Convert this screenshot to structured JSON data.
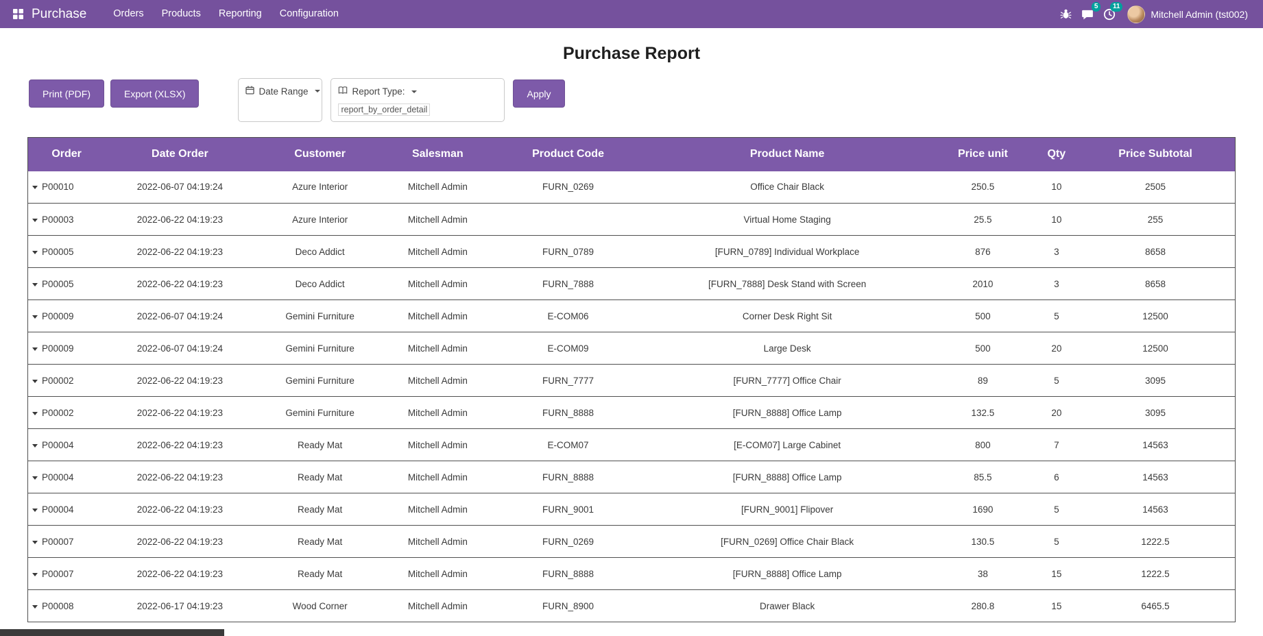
{
  "navbar": {
    "brand": "Purchase",
    "menu_items": [
      "Orders",
      "Products",
      "Reporting",
      "Configuration"
    ],
    "messages_badge": "5",
    "activities_badge": "11",
    "user": "Mitchell Admin (tst002)"
  },
  "page": {
    "title": "Purchase Report",
    "print_button": "Print (PDF)",
    "export_button": "Export (XLSX)",
    "date_range_label": "Date Range",
    "report_type_label": "Report Type:",
    "report_type_value": "report_by_order_detail",
    "apply_button": "Apply"
  },
  "table": {
    "columns": [
      "Order",
      "Date Order",
      "Customer",
      "Salesman",
      "Product Code",
      "Product Name",
      "Price unit",
      "Qty",
      "Price Subtotal"
    ],
    "rows": [
      {
        "order": "P00010",
        "date": "2022-06-07 04:19:24",
        "customer": "Azure Interior",
        "salesman": "Mitchell Admin",
        "code": "FURN_0269",
        "name": "Office Chair Black",
        "price": "250.5",
        "qty": "10",
        "subtotal": "2505"
      },
      {
        "order": "P00003",
        "date": "2022-06-22 04:19:23",
        "customer": "Azure Interior",
        "salesman": "Mitchell Admin",
        "code": "",
        "name": "Virtual Home Staging",
        "price": "25.5",
        "qty": "10",
        "subtotal": "255"
      },
      {
        "order": "P00005",
        "date": "2022-06-22 04:19:23",
        "customer": "Deco Addict",
        "salesman": "Mitchell Admin",
        "code": "FURN_0789",
        "name": "[FURN_0789] Individual Workplace",
        "price": "876",
        "qty": "3",
        "subtotal": "8658"
      },
      {
        "order": "P00005",
        "date": "2022-06-22 04:19:23",
        "customer": "Deco Addict",
        "salesman": "Mitchell Admin",
        "code": "FURN_7888",
        "name": "[FURN_7888] Desk Stand with Screen",
        "price": "2010",
        "qty": "3",
        "subtotal": "8658"
      },
      {
        "order": "P00009",
        "date": "2022-06-07 04:19:24",
        "customer": "Gemini Furniture",
        "salesman": "Mitchell Admin",
        "code": "E-COM06",
        "name": "Corner Desk Right Sit",
        "price": "500",
        "qty": "5",
        "subtotal": "12500"
      },
      {
        "order": "P00009",
        "date": "2022-06-07 04:19:24",
        "customer": "Gemini Furniture",
        "salesman": "Mitchell Admin",
        "code": "E-COM09",
        "name": "Large Desk",
        "price": "500",
        "qty": "20",
        "subtotal": "12500"
      },
      {
        "order": "P00002",
        "date": "2022-06-22 04:19:23",
        "customer": "Gemini Furniture",
        "salesman": "Mitchell Admin",
        "code": "FURN_7777",
        "name": "[FURN_7777] Office Chair",
        "price": "89",
        "qty": "5",
        "subtotal": "3095"
      },
      {
        "order": "P00002",
        "date": "2022-06-22 04:19:23",
        "customer": "Gemini Furniture",
        "salesman": "Mitchell Admin",
        "code": "FURN_8888",
        "name": "[FURN_8888] Office Lamp",
        "price": "132.5",
        "qty": "20",
        "subtotal": "3095"
      },
      {
        "order": "P00004",
        "date": "2022-06-22 04:19:23",
        "customer": "Ready Mat",
        "salesman": "Mitchell Admin",
        "code": "E-COM07",
        "name": "[E-COM07] Large Cabinet",
        "price": "800",
        "qty": "7",
        "subtotal": "14563"
      },
      {
        "order": "P00004",
        "date": "2022-06-22 04:19:23",
        "customer": "Ready Mat",
        "salesman": "Mitchell Admin",
        "code": "FURN_8888",
        "name": "[FURN_8888] Office Lamp",
        "price": "85.5",
        "qty": "6",
        "subtotal": "14563"
      },
      {
        "order": "P00004",
        "date": "2022-06-22 04:19:23",
        "customer": "Ready Mat",
        "salesman": "Mitchell Admin",
        "code": "FURN_9001",
        "name": "[FURN_9001] Flipover",
        "price": "1690",
        "qty": "5",
        "subtotal": "14563"
      },
      {
        "order": "P00007",
        "date": "2022-06-22 04:19:23",
        "customer": "Ready Mat",
        "salesman": "Mitchell Admin",
        "code": "FURN_0269",
        "name": "[FURN_0269] Office Chair Black",
        "price": "130.5",
        "qty": "5",
        "subtotal": "1222.5"
      },
      {
        "order": "P00007",
        "date": "2022-06-22 04:19:23",
        "customer": "Ready Mat",
        "salesman": "Mitchell Admin",
        "code": "FURN_8888",
        "name": "[FURN_8888] Office Lamp",
        "price": "38",
        "qty": "15",
        "subtotal": "1222.5"
      },
      {
        "order": "P00008",
        "date": "2022-06-17 04:19:23",
        "customer": "Wood Corner",
        "salesman": "Mitchell Admin",
        "code": "FURN_8900",
        "name": "Drawer Black",
        "price": "280.8",
        "qty": "15",
        "subtotal": "6465.5"
      }
    ]
  },
  "colors": {
    "navbar_bg": "#75519d",
    "accent": "#7d5aa9",
    "badge_bg": "#00a09d",
    "table_border": "#4f4f4f",
    "status_strip": "#3b3b3b"
  }
}
